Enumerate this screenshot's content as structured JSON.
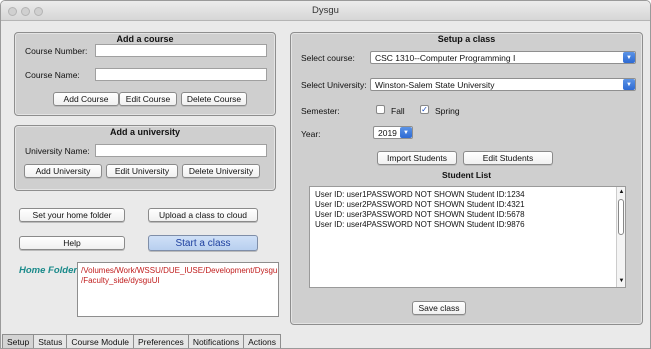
{
  "window": {
    "title": "Dysgu"
  },
  "add_course": {
    "title": "Add a course",
    "course_number_label": "Course Number:",
    "course_name_label": "Course Name:",
    "course_number_value": "",
    "course_name_value": "",
    "buttons": [
      "Add Course",
      "Edit Course",
      "Delete Course"
    ]
  },
  "add_university": {
    "title": "Add a university",
    "university_name_label": "University Name:",
    "university_name_value": "",
    "buttons": [
      "Add University",
      "Edit University",
      "Delete University"
    ]
  },
  "actions": {
    "set_home_folder": "Set your home folder",
    "upload_class": "Upload a class to cloud",
    "help": "Help",
    "start_class": "Start a class"
  },
  "home_folder": {
    "label": "Home Folder:",
    "path": "/Volumes/Work/WSSU/DUE_IUSE/Development/Dysgu\n/Faculty_side/dysguUI"
  },
  "setup_class": {
    "title": "Setup a class",
    "select_course_label": "Select course:",
    "select_course_value": "CSC 1310--Computer Programming I",
    "select_university_label": "Select University:",
    "select_university_value": "Winston-Salem State University",
    "semester_label": "Semester:",
    "fall_label": "Fall",
    "fall_checked": false,
    "spring_label": "Spring",
    "spring_checked": true,
    "year_label": "Year:",
    "year_value": "2019",
    "import_students": "Import Students",
    "edit_students": "Edit Students",
    "student_list_title": "Student List",
    "students": [
      "User ID: user1PASSWORD NOT SHOWN Student ID:1234",
      "User ID: user2PASSWORD NOT SHOWN Student ID:4321",
      "User ID: user3PASSWORD NOT SHOWN Student ID:5678",
      "User ID: user4PASSWORD NOT SHOWN Student ID:9876"
    ],
    "save_class": "Save class"
  },
  "tabs": [
    "Setup",
    "Status",
    "Course Module",
    "Preferences",
    "Notifications",
    "Actions"
  ],
  "icons": {
    "dropdown": "chevron-down-icon",
    "scroll_up": "arrow-up-icon",
    "scroll_down": "arrow-down-icon",
    "check": "check-icon"
  },
  "colors": {
    "home_label": "#1a8a8a",
    "home_path": "#c01d1d",
    "start_class": "#1d3f9e",
    "dropdown_arrow": "#2e6ad3"
  }
}
